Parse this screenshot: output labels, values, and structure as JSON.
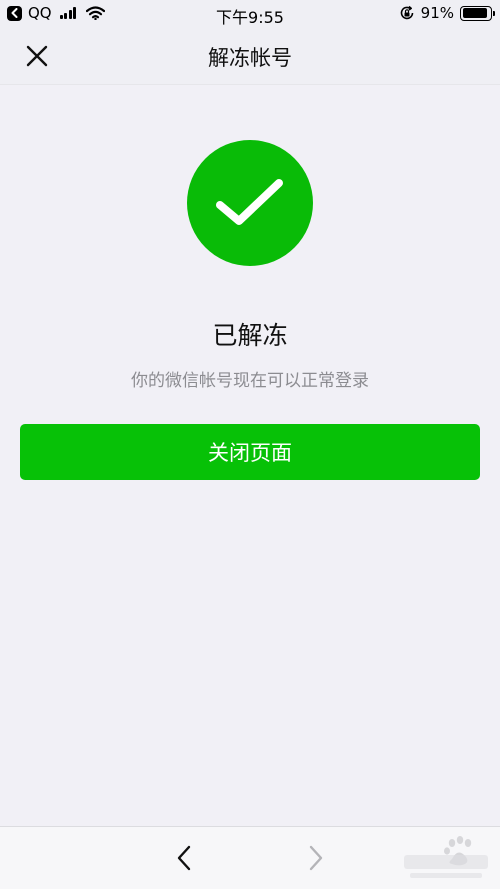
{
  "status_bar": {
    "back_app": "QQ",
    "time": "下午9:55",
    "battery_percent": "91%",
    "battery_level": 0.91,
    "icons": [
      "back-arrow-icon",
      "signal-icon",
      "wifi-icon",
      "orientation-lock-icon",
      "battery-icon"
    ]
  },
  "nav": {
    "title": "解冻帐号",
    "close_icon": "close-icon"
  },
  "result": {
    "icon": "checkmark-icon",
    "title": "已解冻",
    "description": "你的微信帐号现在可以正常登录"
  },
  "actions": {
    "close_page_label": "关闭页面"
  },
  "toolbar": {
    "back_icon": "chevron-left-icon",
    "forward_icon": "chevron-right-icon"
  },
  "colors": {
    "accent_green": "#07c107",
    "background": "#f1f0f6",
    "secondary_text": "#8c8c91"
  }
}
